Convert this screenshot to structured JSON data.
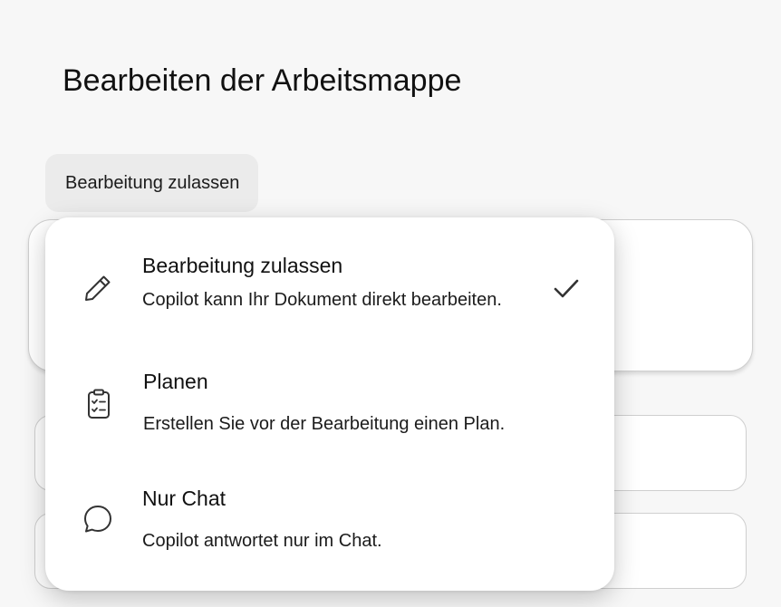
{
  "page": {
    "title": "Bearbeiten der Arbeitsmappe"
  },
  "mode_dropdown": {
    "selected_label": "Bearbeitung zulassen"
  },
  "menu": {
    "items": [
      {
        "title": "Bearbeitung zulassen",
        "description": "Copilot kann Ihr Dokument direkt bearbeiten.",
        "icon": "pencil-icon",
        "selected": true
      },
      {
        "title": "Planen",
        "description": "Erstellen Sie vor der Bearbeitung einen Plan.",
        "icon": "clipboard-checklist-icon",
        "selected": false
      },
      {
        "title": "Nur Chat",
        "description": "Copilot antwortet nur im Chat.",
        "icon": "chat-bubble-icon",
        "selected": false
      }
    ]
  }
}
